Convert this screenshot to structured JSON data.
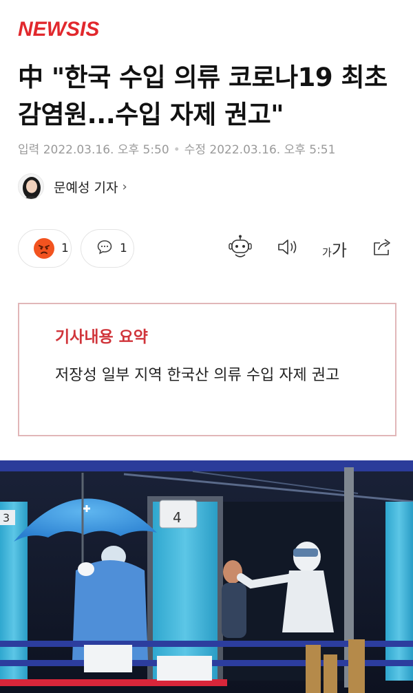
{
  "header": {
    "logo": "NEWSIS"
  },
  "article": {
    "headline": "中 \"한국 수입 의류 코로나19 최초 감염원...수입 자제 권고\"",
    "input_label": "입력",
    "input_time": "2022.03.16. 오후 5:50",
    "modified_label": "수정",
    "modified_time": "2022.03.16. 오후 5:51",
    "reporter": "문예성 기자",
    "reporter_chevron": "›"
  },
  "reactions": {
    "angry_count": "1",
    "comment_count": "1"
  },
  "toolbar": {
    "font_small": "가",
    "font_large": "가"
  },
  "summary": {
    "title": "기사내용 요약",
    "text": "저장성 일부 지역 한국산 의류 수입 자제 권고"
  },
  "photo": {
    "booth_numbers": [
      "3",
      "4"
    ]
  },
  "colors": {
    "brand": "#e1282d",
    "summary_title": "#d0343a",
    "summary_border": "#e1b6b8",
    "angry": "#f2531f"
  },
  "icons": [
    "angry-face-icon",
    "comment-icon",
    "robot-icon",
    "speaker-icon",
    "font-size-icon",
    "share-icon",
    "chevron-right-icon"
  ]
}
